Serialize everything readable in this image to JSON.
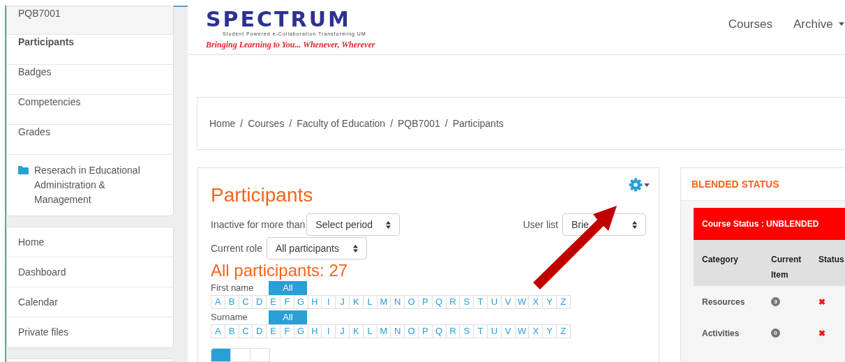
{
  "sidebar": {
    "course_items": [
      {
        "label": "PQB7001",
        "kind": "header"
      },
      {
        "label": "Participants",
        "kind": "active"
      },
      {
        "label": "Badges",
        "kind": "link"
      },
      {
        "label": "Competencies",
        "kind": "link"
      },
      {
        "label": "Grades",
        "kind": "link"
      },
      {
        "label": "Reserach in Educational Administration & Management",
        "kind": "folder"
      }
    ],
    "site_items": [
      "Home",
      "Dashboard",
      "Calendar",
      "Private files"
    ]
  },
  "header": {
    "logo": {
      "name": "SPECTRUM",
      "subtitle": "Student Powered e-Collaboration Transforming UM",
      "tagline": "Bringing Learning to You... Whenever, Wherever"
    },
    "nav": [
      {
        "label": "Courses",
        "dropdown": false
      },
      {
        "label": "Archive",
        "dropdown": true
      }
    ]
  },
  "breadcrumb": {
    "separator": "/",
    "items": [
      "Home",
      "Courses",
      "Faculty of Education",
      "PQB7001",
      "Participants"
    ]
  },
  "participants": {
    "title": "Participants",
    "inactive_label": "Inactive for more than",
    "inactive_value": "Select period",
    "user_list_label": "User list",
    "user_list_value": "Brie",
    "role_label": "Current role",
    "role_value": "All participants",
    "count": "All participants: 27",
    "filters": [
      {
        "label": "First name",
        "all": {
          "label": "All",
          "selected": true
        },
        "letters": [
          "A",
          "B",
          "C",
          "D",
          "E",
          "F",
          "G",
          "H",
          "I",
          "J",
          "K",
          "L",
          "M",
          "N",
          "O",
          "P",
          "Q",
          "R",
          "S",
          "T",
          "U",
          "V",
          "W",
          "X",
          "Y",
          "Z"
        ]
      },
      {
        "label": "Surname",
        "all": {
          "label": "All",
          "selected": true
        },
        "letters": [
          "A",
          "B",
          "C",
          "D",
          "E",
          "F",
          "G",
          "H",
          "I",
          "J",
          "K",
          "L",
          "M",
          "N",
          "O",
          "P",
          "Q",
          "R",
          "S",
          "T",
          "U",
          "V",
          "W",
          "X",
          "Y",
          "Z"
        ]
      }
    ],
    "pages": [
      {
        "selected": true
      },
      {
        "selected": false
      },
      {
        "selected": false
      }
    ]
  },
  "blended": {
    "title": "BLENDED STATUS",
    "course_status": "Course Status : UNBLENDED",
    "columns": [
      "Category",
      "Current Item",
      "Status"
    ],
    "rows": [
      {
        "category": "Resources",
        "count": "3",
        "status": "✖"
      },
      {
        "category": "Activities",
        "count": "0",
        "status": "✖"
      }
    ]
  }
}
